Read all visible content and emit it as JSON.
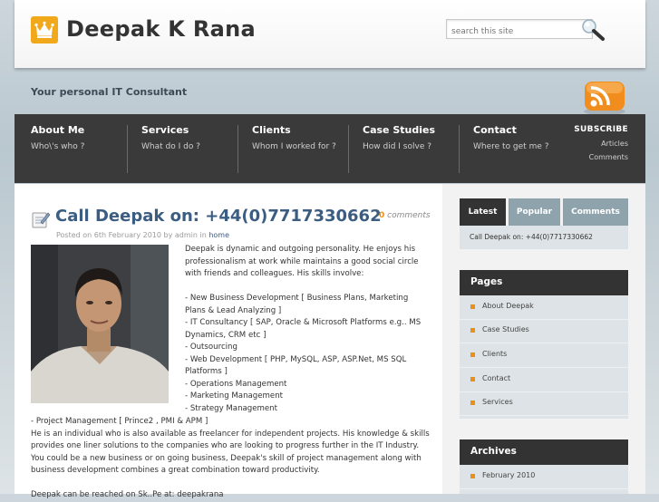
{
  "header": {
    "title": "Deepak K Rana",
    "tagline": "Your personal IT Consultant",
    "search_placeholder": "search this site"
  },
  "nav": {
    "items": [
      {
        "title": "About Me",
        "sub": "Who\\'s who ?"
      },
      {
        "title": "Services",
        "sub": "What do I do ?"
      },
      {
        "title": "Clients",
        "sub": "Whom I worked for ?"
      },
      {
        "title": "Case Studies",
        "sub": "How did I solve ?"
      },
      {
        "title": "Contact",
        "sub": "Where to get me ?"
      }
    ],
    "subscribe": {
      "heading": "SUBSCRIBE",
      "articles": "Articles",
      "comments": "Comments"
    }
  },
  "post": {
    "title": "Call Deepak on: +44(0)7717330662",
    "comment_count": "0",
    "comment_label": "comments",
    "meta_prefix": "Posted on 6th February 2010 by admin in",
    "meta_category": "home",
    "intro": "Deepak is dynamic and outgoing personality. He enjoys his professionalism at work while maintains a good social circle with friends and colleagues. His skills involve:",
    "skills": [
      "- New Business Development [ Business Plans, Marketing Plans & Lead Analyzing ]",
      "- IT Consultancy [ SAP, Oracle & Microsoft Platforms e.g.. MS Dynamics, CRM etc ]",
      "- Outsourcing",
      "- Web Development [ PHP, MySQL, ASP, ASP.Net, MS SQL Platforms ]",
      "- Operations Management",
      "- Marketing Management",
      "- Strategy Management"
    ],
    "pm_line": "- Project Management [ Prince2 , PMI & APM ]",
    "paragraph": "He is an individual who is also available as freelancer for independent projects. His knowledge & skills provides one liner solutions to the companies who are looking to progress further in the IT Industry. You could be a new business or on going business, Deepak's skill of project management along with business development combines a great combination toward productivity.",
    "cut_line": "Deepak can be reached on Sk..Pe at: deepakrana"
  },
  "sidebar": {
    "tabs": [
      "Latest",
      "Popular",
      "Comments"
    ],
    "latest_item": "Call Deepak on: +44(0)7717330662",
    "pages_heading": "Pages",
    "pages": [
      "About Deepak",
      "Case Studies",
      "Clients",
      "Contact",
      "Services"
    ],
    "archives_heading": "Archives",
    "archives": [
      "February 2010"
    ]
  },
  "colors": {
    "accent": "#e8901a",
    "nav_bg": "#3a3a3a",
    "title_blue": "#3b5d82",
    "tab_active": "#333333",
    "tab_inactive": "#8fa3ad"
  },
  "icons": [
    "crown-logo-icon",
    "search-magnifier-icon",
    "rss-feed-icon",
    "post-notepad-icon"
  ]
}
